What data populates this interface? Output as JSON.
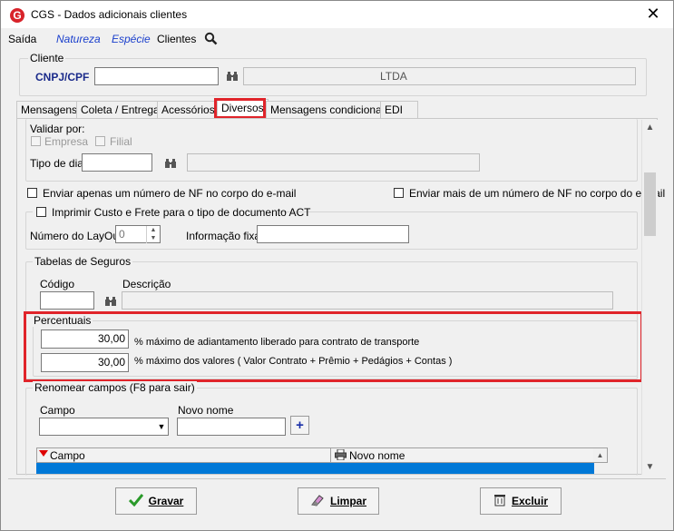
{
  "window": {
    "title": "CGS - Dados adicionais clientes",
    "logo_letter": "G",
    "close_glyph": "✕"
  },
  "menu": {
    "items": [
      "Saída",
      "Natureza",
      "Espécie",
      "Clientes"
    ]
  },
  "cliente": {
    "group_label": "Cliente",
    "cnpj_label": "CNPJ/CPF",
    "cnpj_value": "",
    "name_suffix": "LTDA"
  },
  "tabs": [
    "Mensagens",
    "Coleta / Entrega",
    "Acessórios",
    "Diversos",
    "Mensagens condicionais",
    "EDI"
  ],
  "validar": {
    "label": "Validar por:",
    "empresa": "Empresa",
    "filial": "Filial",
    "tipo_dia_label": "Tipo de dia"
  },
  "options": {
    "enviar_apenas": "Enviar apenas um número de NF no corpo do e-mail",
    "enviar_mais": "Enviar mais de um número de NF no corpo do e-mail"
  },
  "act": {
    "checkbox_label": "Imprimir Custo e Frete para o tipo de documento ACT",
    "layout_label": "Número do LayOut",
    "layout_value": "0",
    "info_label": "Informação fixa"
  },
  "seguros": {
    "group_label": "Tabelas de Seguros",
    "codigo_label": "Código",
    "descricao_label": "Descrição"
  },
  "percentuais": {
    "group_label": "Percentuais",
    "value1": "30,00",
    "label1": "% máximo de adiantamento liberado para contrato de transporte",
    "value2": "30,00",
    "label2": "% máximo dos valores ( Valor Contrato + Prêmio + Pedágios + Contas )"
  },
  "renomear": {
    "group_label": "Renomear campos (F8 para sair)",
    "campo_label": "Campo",
    "novo_nome_label": "Novo nome",
    "col_campo": "Campo",
    "col_novo_nome": "Novo nome"
  },
  "buttons": {
    "gravar": "Gravar",
    "limpar": "Limpar",
    "excluir": "Excluir"
  },
  "colors": {
    "accent_red": "#e0242a",
    "selection_blue": "#0078d7",
    "link_blue": "#1a3fcc"
  }
}
